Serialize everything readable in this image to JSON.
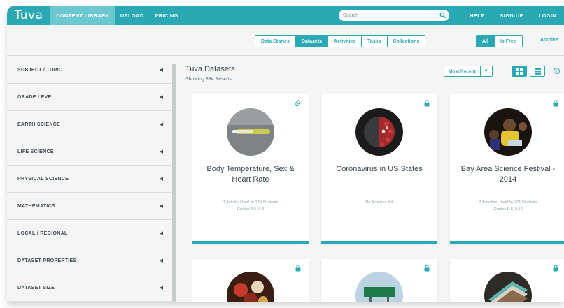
{
  "nav": {
    "logo": "Tuva",
    "links": [
      "CONTENT LIBRARY",
      "UPLOAD",
      "PRICING"
    ],
    "search_placeholder": "Search",
    "right_links": [
      "HELP",
      "SIGN-UP",
      "LOGIN"
    ]
  },
  "filters": {
    "content_types": [
      "Data Stories",
      "Datasets",
      "Activities",
      "Tasks",
      "Collections"
    ],
    "active_type": "Datasets",
    "price": [
      "All",
      "Is Free"
    ],
    "active_price": "All",
    "archive_label": "Archive"
  },
  "sidebar": {
    "items": [
      {
        "label": "SUBJECT / TOPIC"
      },
      {
        "label": "GRADE LEVEL"
      },
      {
        "label": "EARTH SCIENCE"
      },
      {
        "label": "LIFE SCIENCE"
      },
      {
        "label": "PHYSICAL SCIENCE"
      },
      {
        "label": "MATHEMATICS"
      },
      {
        "label": "LOCAL / REGIONAL"
      },
      {
        "label": "DATASET PROPERTIES"
      },
      {
        "label": "DATASET SIZE"
      }
    ]
  },
  "main": {
    "title": "Tuva Datasets",
    "subtitle": "Showing 384 Results",
    "sort_label": "Most Recent",
    "cards": [
      {
        "title": "Body Temperature, Sex & Heart Rate",
        "meta": "1 Activity, Used by 289 Students",
        "grades": "Grades 3-5, 6-8",
        "corner_icon": "paperclip-icon"
      },
      {
        "title": "Coronavirus in US States",
        "meta": "No Activities Yet",
        "grades": "",
        "corner_icon": "lock-icon"
      },
      {
        "title": "Bay Area Science Festival - 2014",
        "meta": "2 Activities, Used by 201 Students",
        "grades": "Grades 6-8, 9-12",
        "corner_icon": "lock-icon"
      }
    ]
  },
  "colors": {
    "brand": "#2aa9b5",
    "active_tab": "#6cc8d0"
  }
}
